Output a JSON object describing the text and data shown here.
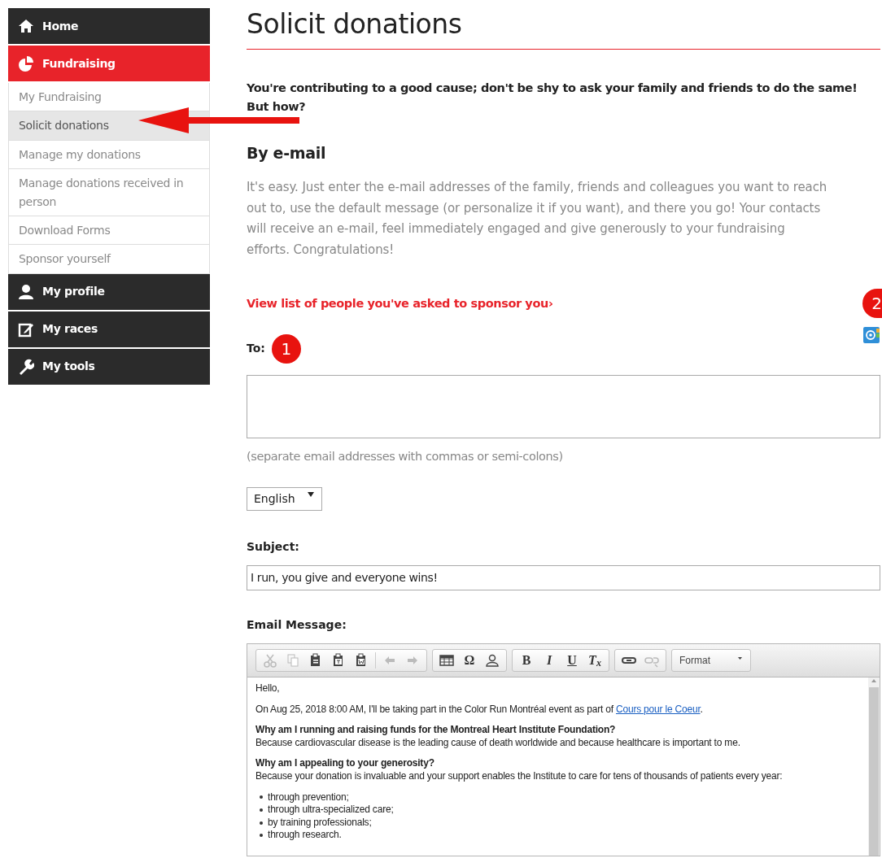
{
  "sidebar": {
    "items": [
      {
        "kind": "section",
        "label": "Home",
        "selected": false
      },
      {
        "kind": "section",
        "label": "Fundraising",
        "selected": true
      },
      {
        "kind": "sub",
        "label": "My Fundraising",
        "selected": false
      },
      {
        "kind": "sub",
        "label": "Solicit donations",
        "selected": true
      },
      {
        "kind": "sub",
        "label": "Manage my donations",
        "selected": false
      },
      {
        "kind": "sub",
        "label": "Manage donations received in person",
        "selected": false
      },
      {
        "kind": "sub",
        "label": "Download Forms",
        "selected": false
      },
      {
        "kind": "sub",
        "label": "Sponsor yourself",
        "selected": false
      },
      {
        "kind": "section",
        "label": "My profile",
        "selected": false
      },
      {
        "kind": "section",
        "label": "My races",
        "selected": false
      },
      {
        "kind": "section",
        "label": "My tools",
        "selected": false
      }
    ]
  },
  "main": {
    "title": "Solicit donations",
    "intro": "You're contributing to a good cause; don't be shy to ask your family and friends to do the same! But how?",
    "section_heading": "By e-mail",
    "description": "It's easy. Just enter the e-mail addresses of the family, friends and colleagues you want to reach out to, use the default message (or personalize it if you want), and there you go! Your contacts will receive an e-mail, feel immediately engaged and give generously to your fundraising efforts. Congratulations!",
    "list_link": "View list of people you've asked to sponsor you›",
    "to_label": "To:",
    "to_hint": "(separate email addresses with commas or semi-colons)",
    "language": "English",
    "subject_label": "Subject:",
    "subject_value": "I run, you give and everyone wins!",
    "message_label": "Email Message:"
  },
  "callouts": [
    {
      "label": "1"
    },
    {
      "label": "2"
    }
  ],
  "editor": {
    "toolbar": [
      [
        {
          "kind": "icon",
          "disabled": true
        },
        {
          "kind": "icon",
          "disabled": true
        },
        {
          "kind": "icon",
          "disabled": false
        },
        {
          "kind": "icon",
          "disabled": false
        },
        {
          "kind": "icon",
          "disabled": false
        },
        {
          "kind": "separator"
        },
        {
          "kind": "icon",
          "disabled": true
        },
        {
          "kind": "icon",
          "disabled": true
        }
      ],
      [
        {
          "kind": "icon",
          "disabled": false
        },
        {
          "kind": "text",
          "label": "Ω"
        },
        {
          "kind": "icon",
          "disabled": false
        }
      ],
      [
        {
          "kind": "text",
          "label": "B"
        },
        {
          "kind": "text",
          "label": "I"
        },
        {
          "kind": "text",
          "label": "U"
        },
        {
          "kind": "text",
          "label": "T$_{x}$"
        }
      ],
      [
        {
          "kind": "icon",
          "disabled": false
        },
        {
          "kind": "icon",
          "disabled": true
        }
      ],
      [
        {
          "kind": "dropdown",
          "label": "Format"
        }
      ]
    ],
    "body": [
      {
        "kind": "para",
        "text": "Hello,"
      },
      {
        "kind": "para",
        "text": "On Aug 25, 2018 8:00 AM, I'll be taking part in the Color Run Montréal event as part of ",
        "link": "Cours pour le Coeur",
        "after": "."
      },
      {
        "kind": "question",
        "title": "Why am I running and raising funds for the Montreal Heart Institute Foundation?",
        "text": "Because cardiovascular disease is the leading cause of death worldwide and because healthcare is important to me."
      },
      {
        "kind": "question",
        "title": "Why am I appealing to your generosity?",
        "text": "Because your donation is invaluable and your support enables the Institute to care for tens of thousands of patients every year:"
      },
      {
        "kind": "bullets",
        "items": [
          "through prevention;",
          "through ultra-specialized care;",
          "by training professionals;",
          "through research."
        ]
      }
    ]
  }
}
